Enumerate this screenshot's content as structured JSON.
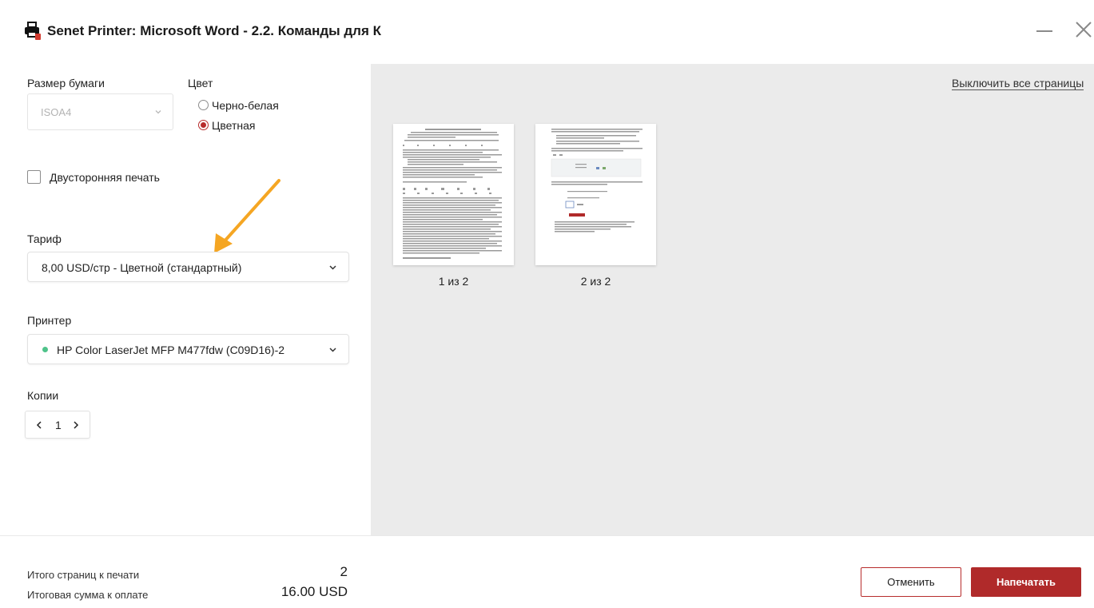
{
  "window": {
    "title": "Senet Printer: Microsoft Word - 2.2. Команды для К"
  },
  "settings": {
    "paper_size_label": "Размер бумаги",
    "paper_size_value": "ISOA4",
    "color_label": "Цвет",
    "color_options": [
      {
        "label": "Черно-белая",
        "selected": false
      },
      {
        "label": "Цветная",
        "selected": true
      }
    ],
    "duplex_label": "Двусторонняя печать",
    "duplex_checked": false,
    "tariff_label": "Тариф",
    "tariff_value": "8,00 USD/стр - Цветной (стандартный)",
    "printer_label": "Принтер",
    "printer_value": "HP Color LaserJet MFP M477fdw (C09D16)-2",
    "printer_status_color": "#4fc38a",
    "copies_label": "Копии",
    "copies_value": "1"
  },
  "preview": {
    "toggle_all_label": "Выключить все страницы",
    "pages": [
      {
        "caption": "1 из 2"
      },
      {
        "caption": "2 из 2"
      }
    ]
  },
  "footer": {
    "total_pages_label": "Итого страниц к печати",
    "total_pages_value": "2",
    "total_amount_label": "Итоговая сумма к оплате",
    "total_amount_value": "16.00 USD",
    "cancel_label": "Отменить",
    "print_label": "Напечатать"
  },
  "colors": {
    "accent": "#b02a2a",
    "annotation_arrow": "#f5a623"
  }
}
